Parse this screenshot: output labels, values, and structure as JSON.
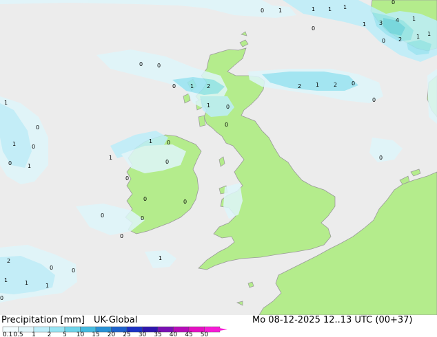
{
  "header": {
    "variable": "Precipitation [mm]",
    "model": "UK-Global",
    "valid_time": "Mo 08-12-2025 12..13 UTC (00+37)"
  },
  "legend": {
    "ticks": [
      "0.1",
      "0.5",
      "1",
      "2",
      "5",
      "10",
      "15",
      "20",
      "25",
      "30",
      "35",
      "40",
      "45",
      "50"
    ],
    "colors": [
      "#f2fdff",
      "#dff6fb",
      "#bdeefa",
      "#97e4f3",
      "#6fd4ea",
      "#44bbe0",
      "#2a92d6",
      "#1e62cc",
      "#1c32c5",
      "#2e16ad",
      "#7a10b3",
      "#b60cb8",
      "#e410c2",
      "#f71bd6"
    ]
  },
  "colors": {
    "sea": "#ececec",
    "land": "#b4ec8c",
    "coast": "#9a9a9a"
  },
  "map_labels": [
    {
      "text": "0"
    },
    {
      "text": "1"
    },
    {
      "text": "1"
    },
    {
      "text": "1"
    },
    {
      "text": "0"
    },
    {
      "text": "1"
    },
    {
      "text": "3"
    },
    {
      "text": "4"
    },
    {
      "text": "1"
    },
    {
      "text": "1"
    },
    {
      "text": "2"
    },
    {
      "text": "0"
    },
    {
      "text": "1"
    },
    {
      "text": "1"
    },
    {
      "text": "0"
    },
    {
      "text": "0"
    },
    {
      "text": "0"
    },
    {
      "text": "0"
    },
    {
      "text": "1"
    },
    {
      "text": "2"
    },
    {
      "text": "2"
    },
    {
      "text": "1"
    },
    {
      "text": "2"
    },
    {
      "text": "0"
    },
    {
      "text": "0"
    },
    {
      "text": "1"
    },
    {
      "text": "0"
    },
    {
      "text": "0"
    },
    {
      "text": "1"
    },
    {
      "text": "0"
    },
    {
      "text": "1"
    },
    {
      "text": "0"
    },
    {
      "text": "0"
    },
    {
      "text": "1"
    },
    {
      "text": "1"
    },
    {
      "text": "0"
    },
    {
      "text": "1"
    },
    {
      "text": "0"
    },
    {
      "text": "0"
    },
    {
      "text": "0"
    },
    {
      "text": "0"
    },
    {
      "text": "0"
    },
    {
      "text": "0"
    },
    {
      "text": "0"
    },
    {
      "text": "1"
    },
    {
      "text": "2"
    },
    {
      "text": "0"
    },
    {
      "text": "0"
    },
    {
      "text": "1"
    },
    {
      "text": "1"
    },
    {
      "text": "1"
    },
    {
      "text": "0"
    },
    {
      "text": "0"
    }
  ]
}
